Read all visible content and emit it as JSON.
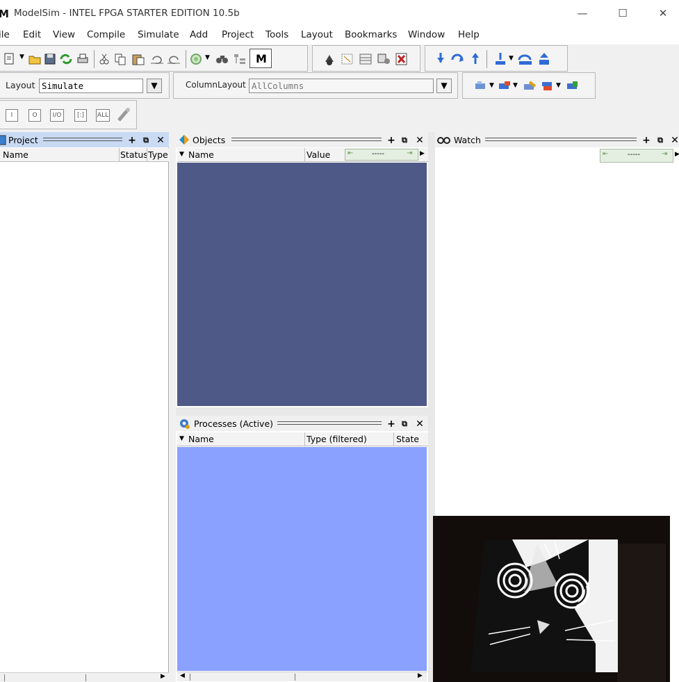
{
  "window": {
    "title": "ModelSim - INTEL FPGA STARTER EDITION 10.5b",
    "logo_text": "M",
    "minimize_glyph": "—",
    "maximize_glyph": "☐",
    "close_glyph": "✕"
  },
  "menubar": {
    "items": [
      "ile",
      "Edit",
      "View",
      "Compile",
      "Simulate",
      "Add",
      "Project",
      "Tools",
      "Layout",
      "Bookmarks",
      "Window",
      "Help"
    ]
  },
  "layout_bar": {
    "layout_label": "Layout",
    "layout_value": "Simulate",
    "column_label": "ColumnLayout",
    "column_value": "AllColumns"
  },
  "mode_buttons": [
    "I",
    "O",
    "I/O",
    "[:]",
    "ALL"
  ],
  "panes": {
    "project": {
      "title": "Project",
      "columns": [
        "Name",
        "Status",
        "Type"
      ]
    },
    "objects": {
      "title": "Objects",
      "columns": [
        "Name",
        "Value"
      ],
      "cursor_value": "-----"
    },
    "watch": {
      "title": "Watch",
      "cursor_value": "-----"
    },
    "processes": {
      "title": "Processes (Active)",
      "columns": [
        "Name",
        "Type (filtered)",
        "State"
      ]
    }
  },
  "pane_controls": {
    "add": "+",
    "undock": "⧉",
    "close": "✕"
  },
  "colors": {
    "objects_bg": "#4f5987",
    "processes_bg": "#8aa1ff",
    "project_header": "#c9daf2",
    "accent_icon_blue": "#2f6bd6",
    "accent_icon_green": "#33a133",
    "accent_icon_red": "#c02424"
  },
  "overlay": {
    "type": "webcam-thumbnail",
    "subject": "cat-hypno-eyes-image"
  }
}
